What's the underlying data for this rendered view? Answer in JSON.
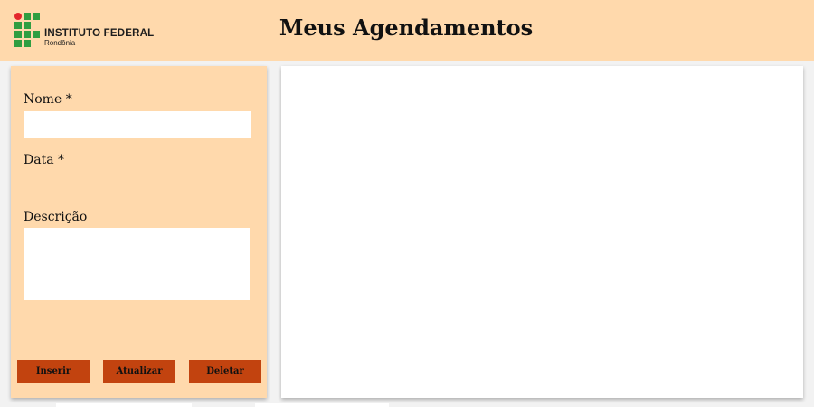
{
  "header": {
    "logo": {
      "title": "INSTITUTO FEDERAL",
      "subtitle": "Rondônia",
      "colors": {
        "dot": "#e3262b",
        "squares": "#2f9e41"
      }
    },
    "title": "Meus Agendamentos"
  },
  "form": {
    "nome": {
      "label": "Nome *",
      "value": ""
    },
    "data": {
      "label": "Data *",
      "value": ""
    },
    "descricao": {
      "label": "Descrição",
      "value": ""
    },
    "buttons": {
      "insert": "Inserir",
      "update": "Atualizar",
      "delete": "Deletar"
    }
  },
  "colors": {
    "header_bg": "#ffd9ac",
    "panel_bg": "#ffd9ac",
    "button_bg": "#c2430f",
    "page_bg": "#f2f2f2"
  }
}
